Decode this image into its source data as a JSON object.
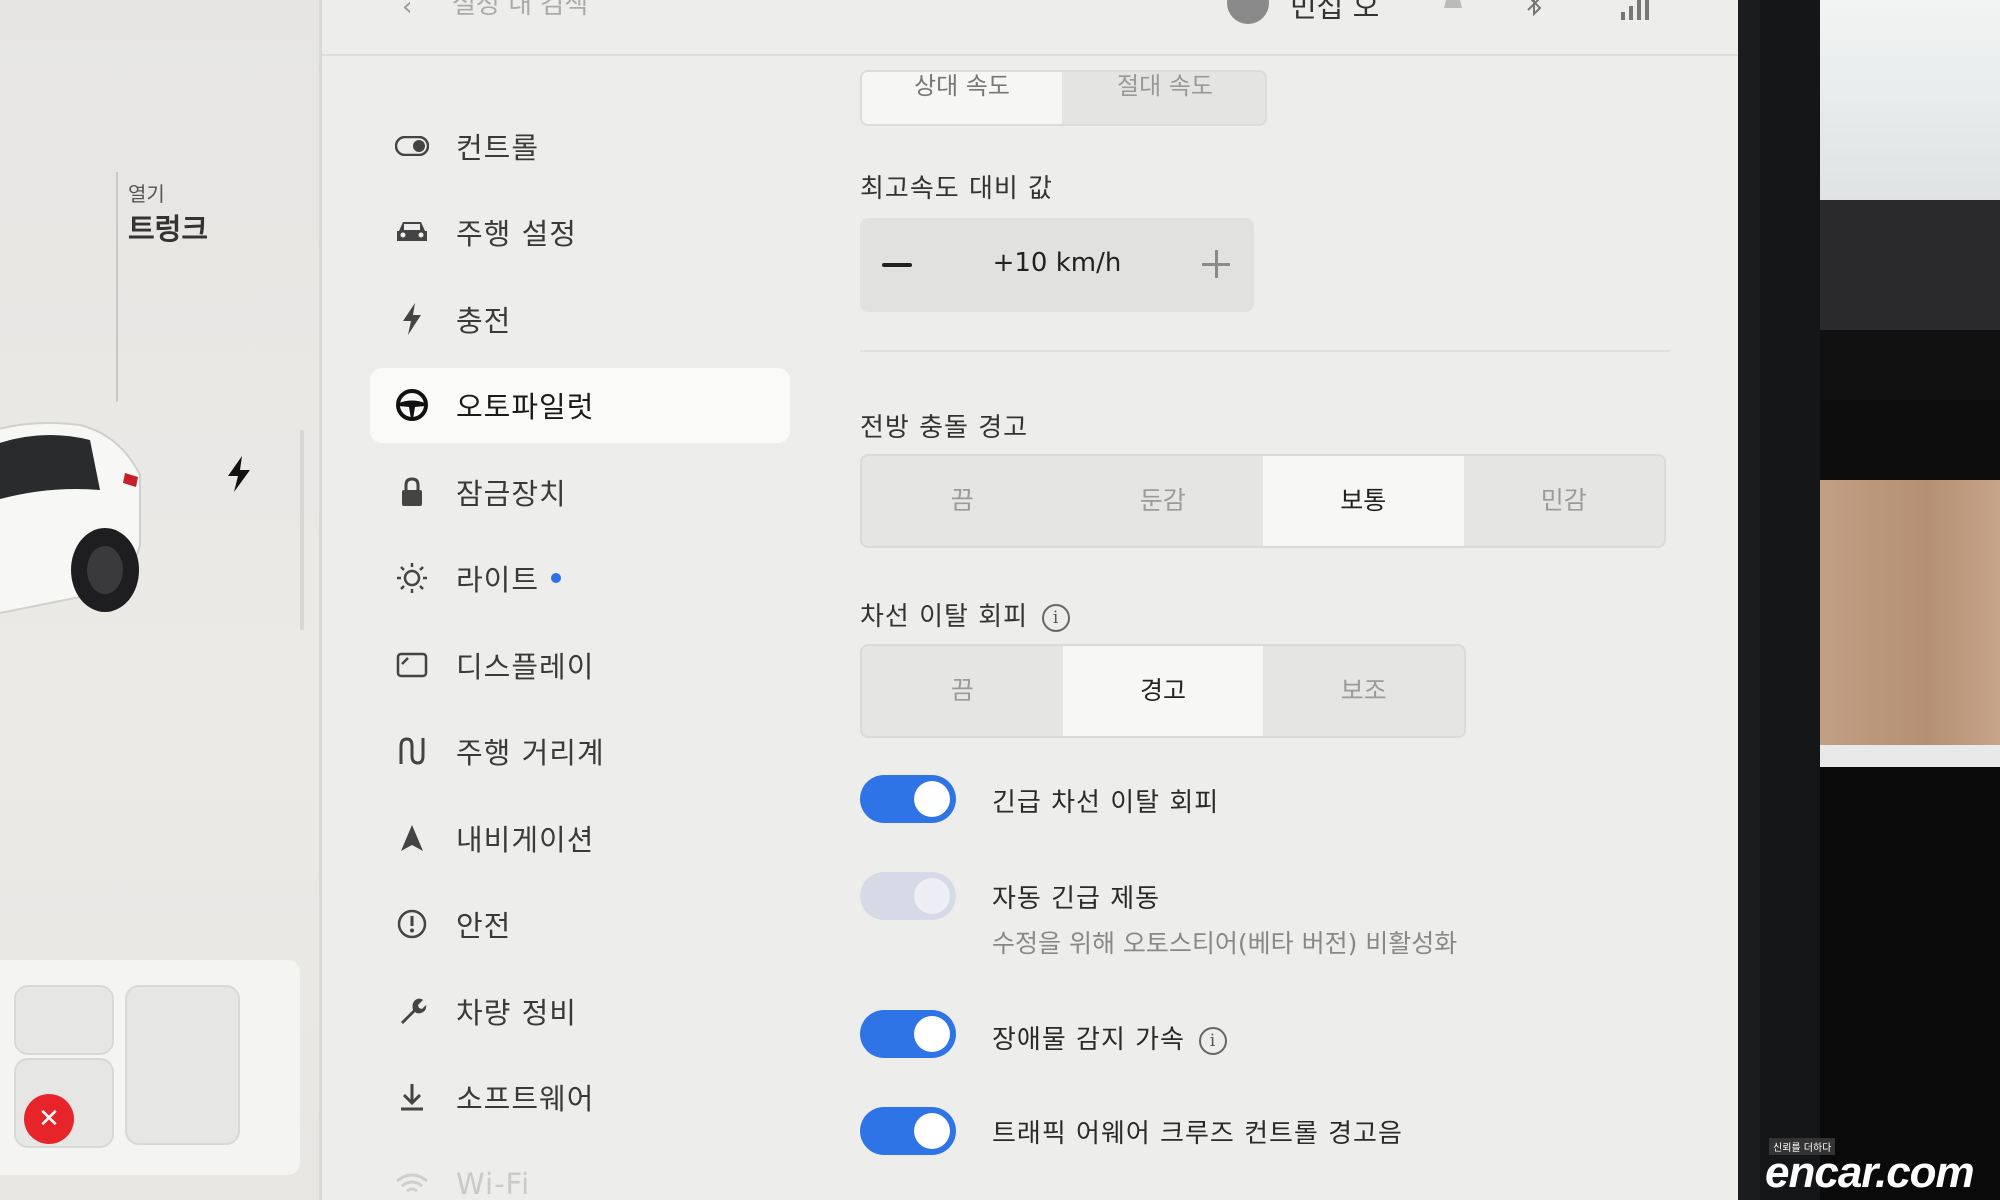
{
  "topbar": {
    "search_placeholder": "설정 내 검색",
    "profile_name": "민섭 오"
  },
  "car": {
    "trunk_open_label": "열기",
    "trunk_title": "트렁크"
  },
  "sidebar": {
    "items": [
      {
        "label": "컨트롤",
        "icon": "toggle-icon"
      },
      {
        "label": "주행 설정",
        "icon": "car-icon"
      },
      {
        "label": "충전",
        "icon": "bolt-icon"
      },
      {
        "label": "오토파일럿",
        "icon": "steering-wheel-icon",
        "active": true
      },
      {
        "label": "잠금장치",
        "icon": "lock-icon"
      },
      {
        "label": "라이트",
        "icon": "sun-icon",
        "badge_color": "#2d6fe6"
      },
      {
        "label": "디스플레이",
        "icon": "display-icon"
      },
      {
        "label": "주행 거리계",
        "icon": "trip-icon"
      },
      {
        "label": "내비게이션",
        "icon": "navigation-icon"
      },
      {
        "label": "안전",
        "icon": "safety-icon"
      },
      {
        "label": "차량 정비",
        "icon": "wrench-icon"
      },
      {
        "label": "소프트웨어",
        "icon": "download-icon"
      },
      {
        "label": "Wi-Fi",
        "icon": "wifi-icon"
      }
    ]
  },
  "content": {
    "speed_mode": {
      "options": [
        "상대 속도",
        "절대 속도"
      ],
      "selected": "상대 속도"
    },
    "speed_offset": {
      "title": "최고속도 대비 값",
      "value": "+10 km/h"
    },
    "forward_collision": {
      "title": "전방 충돌 경고",
      "options": [
        "끔",
        "둔감",
        "보통",
        "민감"
      ],
      "selected": "보통"
    },
    "lane_departure": {
      "title": "차선 이탈 회피",
      "options": [
        "끔",
        "경고",
        "보조"
      ],
      "selected": "경고"
    },
    "toggles": [
      {
        "label": "긴급 차선 이탈 회피",
        "on": true,
        "enabled": true
      },
      {
        "label": "자동 긴급 제동",
        "sub": "수정을 위해 오토스티어(베타 버전) 비활성화",
        "on": true,
        "enabled": false
      },
      {
        "label": "장애물 감지 가속",
        "on": true,
        "enabled": true,
        "info": true
      },
      {
        "label": "트래픽 어웨어 크루즈 컨트롤 경고음",
        "on": true,
        "enabled": true
      }
    ]
  },
  "colors": {
    "accent": "#2f74e6",
    "badge": "#2d6fe6",
    "alert": "#e8242b"
  },
  "watermark": {
    "small": "신뢰를 더하다",
    "brand": "encar.com"
  }
}
